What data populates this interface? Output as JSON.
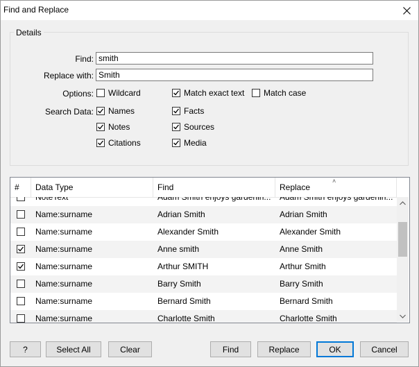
{
  "window": {
    "title": "Find and Replace"
  },
  "details": {
    "group_label": "Details",
    "find_label": "Find:",
    "find_value": "smith",
    "replace_label": "Replace with:",
    "replace_value": "Smith",
    "options_label": "Options:",
    "options": [
      {
        "label": "Wildcard",
        "checked": false
      },
      {
        "label": "Match exact text",
        "checked": true
      },
      {
        "label": "Match case",
        "checked": false
      }
    ],
    "search_label": "Search Data:",
    "search": [
      {
        "label": "Names",
        "checked": true
      },
      {
        "label": "Facts",
        "checked": true
      },
      {
        "label": "Notes",
        "checked": true
      },
      {
        "label": "Sources",
        "checked": true
      },
      {
        "label": "Citations",
        "checked": true
      },
      {
        "label": "Media",
        "checked": true
      }
    ]
  },
  "results": {
    "columns": [
      "#",
      "Data Type",
      "Find",
      "Replace"
    ],
    "sort_indicator": "˄",
    "rows": [
      {
        "checked": false,
        "type": "NoteText",
        "find": "Adam Smith enjoys gardenin...",
        "replace": "Adam Smith enjoys gardenin..."
      },
      {
        "checked": false,
        "type": "Name:surname",
        "find": "Adrian Smith",
        "replace": "Adrian Smith"
      },
      {
        "checked": false,
        "type": "Name:surname",
        "find": "Alexander Smith",
        "replace": "Alexander Smith"
      },
      {
        "checked": true,
        "type": "Name:surname",
        "find": "Anne smith",
        "replace": "Anne Smith"
      },
      {
        "checked": true,
        "type": "Name:surname",
        "find": "Arthur SMITH",
        "replace": "Arthur Smith"
      },
      {
        "checked": false,
        "type": "Name:surname",
        "find": "Barry Smith",
        "replace": "Barry Smith"
      },
      {
        "checked": false,
        "type": "Name:surname",
        "find": "Bernard Smith",
        "replace": "Bernard Smith"
      },
      {
        "checked": false,
        "type": "Name:surname",
        "find": "Charlotte Smith",
        "replace": "Charlotte Smith"
      }
    ]
  },
  "buttons": {
    "help": "?",
    "select_all": "Select All",
    "clear": "Clear",
    "find": "Find",
    "replace": "Replace",
    "ok": "OK",
    "cancel": "Cancel"
  },
  "colors": {
    "default_button_border": "#0078d7",
    "alt_row": "#f3f3f3"
  }
}
